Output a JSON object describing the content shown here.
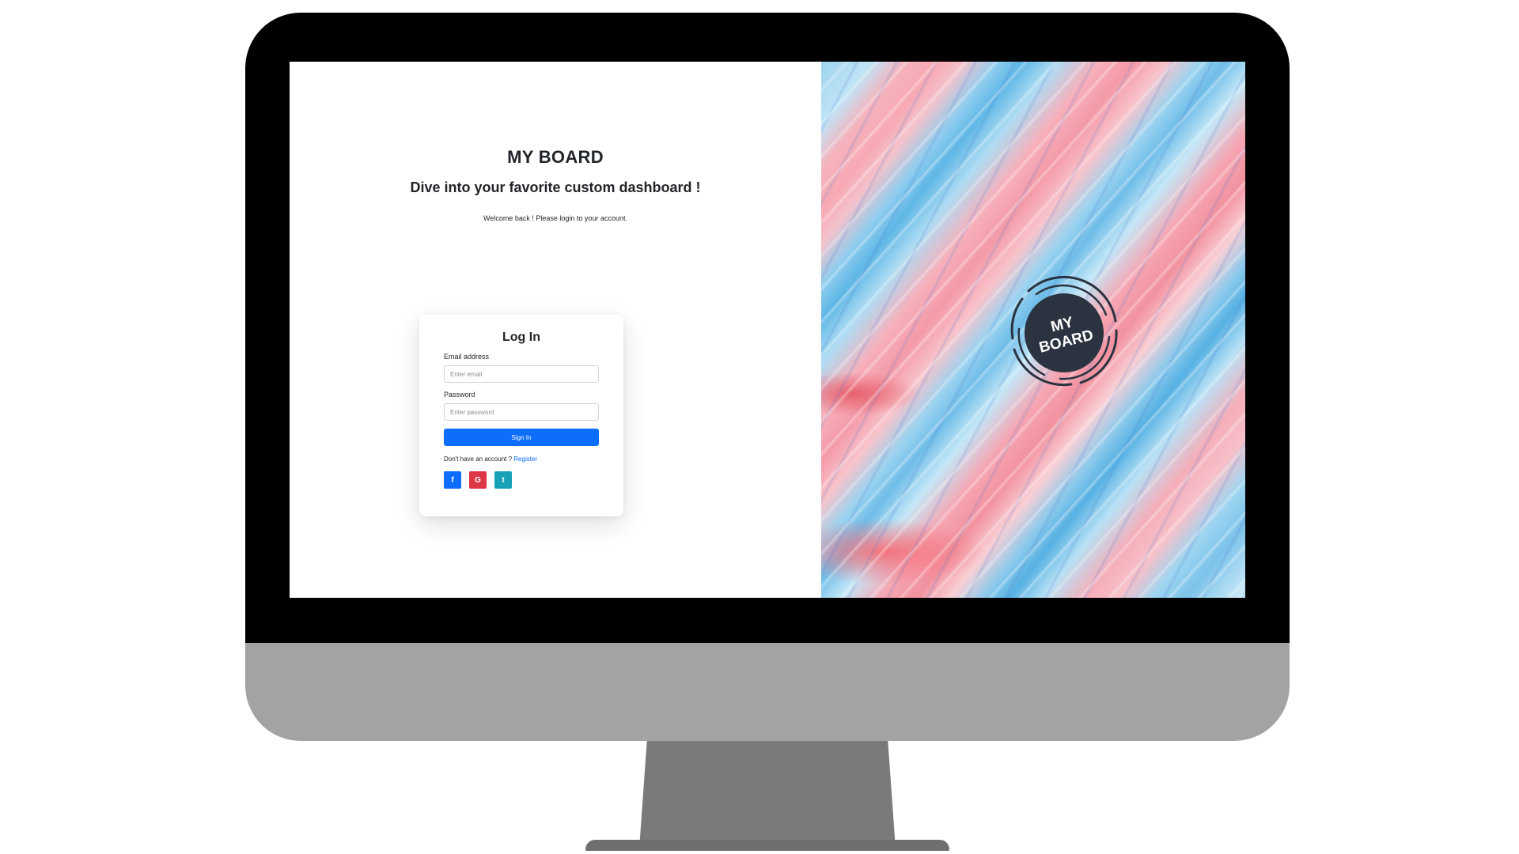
{
  "left": {
    "brand_title": "MY BOARD",
    "tagline": "Dive into your favorite custom dashboard !",
    "welcome": "Welcome back ! Please login to your account."
  },
  "login": {
    "title": "Log In",
    "email_label": "Email address",
    "email_placeholder": "Enter email",
    "password_label": "Password",
    "password_placeholder": "Enter password",
    "sign_in": "Sign In",
    "no_account": "Don't have an account ? ",
    "register": "Register",
    "social": [
      {
        "icon": "facebook-icon",
        "glyph": "f",
        "color": "#0d6efd"
      },
      {
        "icon": "google-icon",
        "glyph": "G",
        "color": "#dc3545"
      },
      {
        "icon": "twitter-icon",
        "glyph": "t",
        "color": "#17a2b8"
      }
    ]
  },
  "logo": {
    "line1": "MY",
    "line2": "BOARD"
  },
  "colors": {
    "primary": "#0d6efd",
    "badge": "#2b3340",
    "bezel": "#000000",
    "chin": "#a3a3a3"
  }
}
